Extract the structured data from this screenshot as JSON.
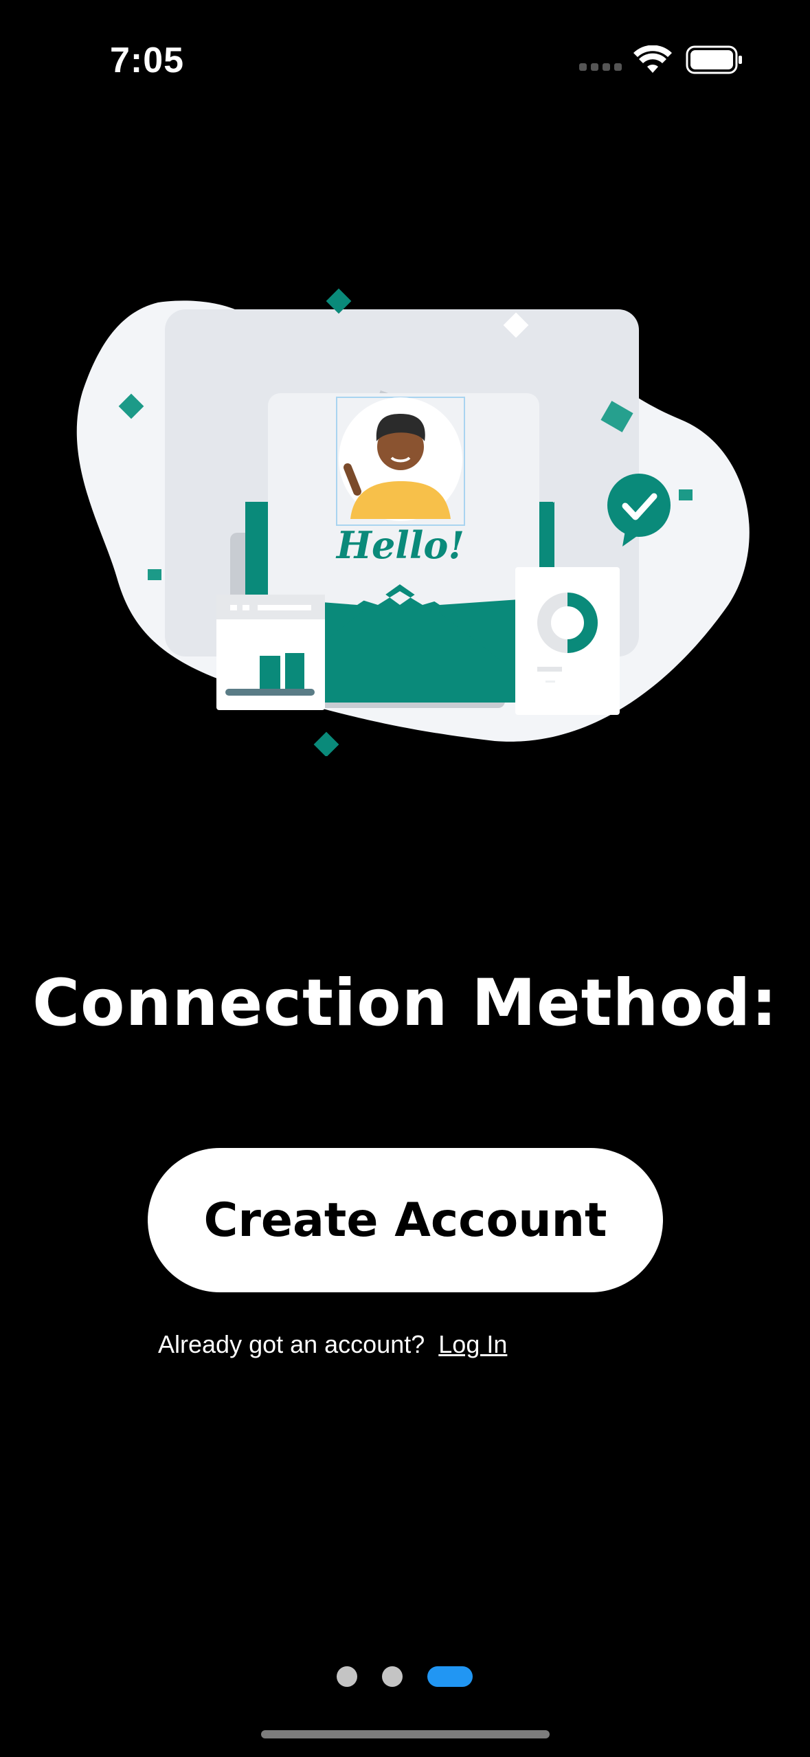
{
  "status_bar": {
    "time": "7:05",
    "icons": [
      "cellular-signal-icon",
      "wifi-icon",
      "battery-icon"
    ]
  },
  "illustration": {
    "greeting": "Hello!",
    "icons": [
      "envelope-icon",
      "avatar-waving-icon",
      "checkmark-chat-icon",
      "bar-chart-card-icon",
      "donut-chart-card-icon"
    ]
  },
  "onboarding": {
    "title": "Connection Method:",
    "primary_button": "Create Account",
    "login_prompt": "Already got an account?",
    "login_link": "Log In"
  },
  "pagination": {
    "total": 3,
    "active_index": 2
  },
  "colors": {
    "background": "#000000",
    "accent_teal": "#0a8a7a",
    "active_dot": "#2196f3",
    "inactive_dot": "#c4c4c4"
  }
}
